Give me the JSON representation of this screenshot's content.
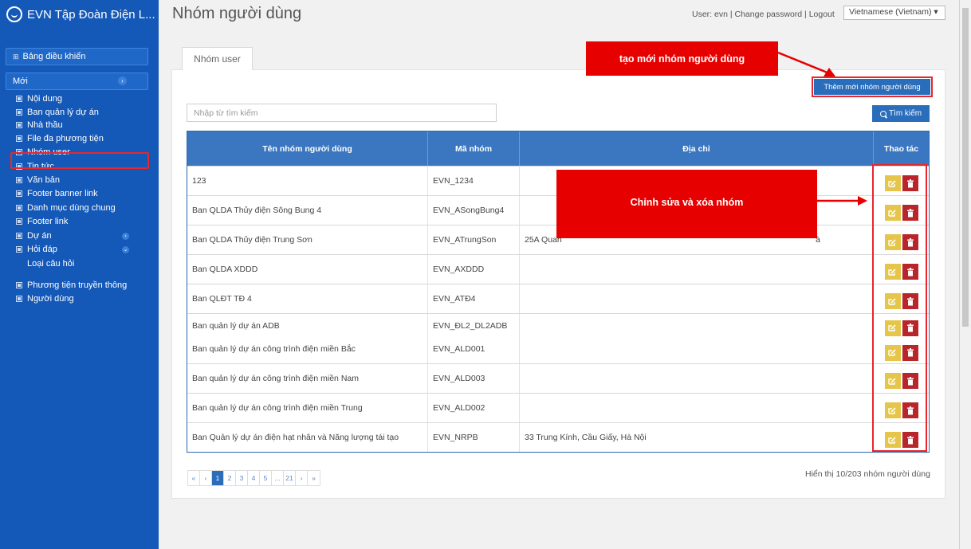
{
  "app": {
    "title": "EVN Tập Đoàn Điện L..."
  },
  "sidebar": {
    "dashboard": "Bảng điều khiển",
    "new_label": "Mới",
    "items": [
      {
        "label": "Nội dung"
      },
      {
        "label": "Ban quản lý dự án"
      },
      {
        "label": "Nhà thầu"
      },
      {
        "label": "File đa phương tiện"
      },
      {
        "label": "Nhóm user"
      },
      {
        "label": "Tin tức"
      },
      {
        "label": "Văn bản"
      },
      {
        "label": "Footer banner link"
      },
      {
        "label": "Danh mục dùng chung"
      },
      {
        "label": "Footer link"
      },
      {
        "label": "Dự án"
      },
      {
        "label": "Hỏi đáp"
      },
      {
        "label": "Loại câu hỏi"
      },
      {
        "label": "Phương tiện truyền thông"
      },
      {
        "label": "Người dùng"
      }
    ]
  },
  "header": {
    "page_title": "Nhóm người dùng",
    "user_text": "User: evn",
    "change_password": "Change password",
    "logout": "Logout",
    "language": "Vietnamese (Vietnam)"
  },
  "main": {
    "tab_label": "Nhóm user",
    "add_button": "Thêm mới nhóm người dùng",
    "search_placeholder": "Nhập từ tìm kiếm",
    "search_button": "Tìm kiếm",
    "table": {
      "headers": [
        "Tên nhóm người dùng",
        "Mã nhóm",
        "Địa chỉ",
        "Thao tác"
      ],
      "rows": [
        {
          "name": "123",
          "code": "EVN_1234",
          "address": ""
        },
        {
          "name": "Ban QLDA Thủy điện Sông Bung 4",
          "code": "EVN_ASongBung4",
          "address": ""
        },
        {
          "name": "Ban QLDA Thủy điện Trung Sơn",
          "code": "EVN_ATrungSon",
          "address": "25A Quan",
          "address_tail": "à"
        },
        {
          "name": "Ban QLDA XDDD",
          "code": "EVN_AXDDD",
          "address": ""
        },
        {
          "name": "Ban QLĐT TĐ 4",
          "code": "EVN_ATĐ4",
          "address": ""
        },
        {
          "name": "Ban quản lý dự án ADB",
          "code": "EVN_ĐL2_DL2ADB",
          "address": ""
        },
        {
          "name": "Ban quản lý dự án công trình điện miền Bắc",
          "code": "EVN_ALD001",
          "address": ""
        },
        {
          "name": "Ban quản lý dự án công trình điện miền Nam",
          "code": "EVN_ALD003",
          "address": ""
        },
        {
          "name": "Ban quản lý dự án công trình điện miền Trung",
          "code": "EVN_ALD002",
          "address": ""
        },
        {
          "name": "Ban Quản lý dự án điện hạt nhân và Năng lượng tái tạo",
          "code": "EVN_NRPB",
          "address": "33 Trung Kính, Cầu Giấy, Hà Nội"
        }
      ]
    },
    "pagination": [
      "«",
      "‹",
      "1",
      "2",
      "3",
      "4",
      "5",
      "...",
      "21",
      "›",
      "»"
    ],
    "page_info": "Hiển thị 10/203 nhóm người dùng"
  },
  "annotations": {
    "add_callout": "tạo mới nhóm người dùng",
    "edit_callout": "Chỉnh sửa và xóa nhóm"
  },
  "colors": {
    "sidebar": "#1559b8",
    "primary": "#2a6ebb",
    "header_row": "#3a77c0",
    "edit": "#e5c64b",
    "delete": "#b8262b",
    "annotation": "#e60000"
  }
}
